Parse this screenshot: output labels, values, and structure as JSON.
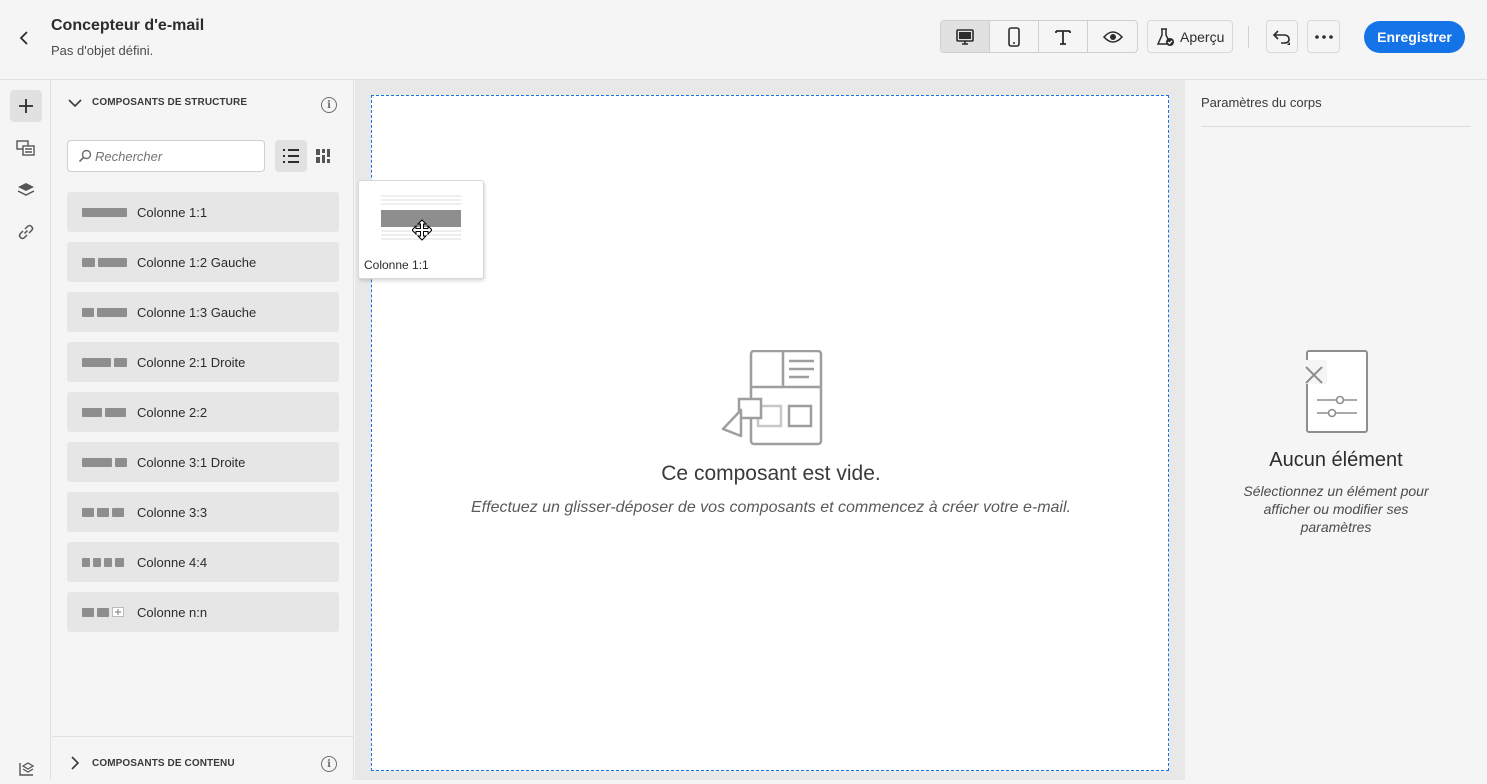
{
  "header": {
    "title": "Concepteur d'e-mail",
    "subtitle": "Pas d'objet défini.",
    "preview_label": "Aperçu",
    "save_label": "Enregistrer"
  },
  "left_panel": {
    "structure_title": "COMPOSANTS DE STRUCTURE",
    "search_placeholder": "Rechercher",
    "items": [
      {
        "label": "Colonne 1:1"
      },
      {
        "label": "Colonne 1:2 Gauche"
      },
      {
        "label": "Colonne 1:3 Gauche"
      },
      {
        "label": "Colonne 2:1 Droite"
      },
      {
        "label": "Colonne 2:2"
      },
      {
        "label": "Colonne 3:1 Droite"
      },
      {
        "label": "Colonne 3:3"
      },
      {
        "label": "Colonne 4:4"
      },
      {
        "label": "Colonne n:n"
      }
    ],
    "content_title": "COMPOSANTS DE CONTENU"
  },
  "canvas": {
    "empty_title": "Ce composant est vide.",
    "empty_desc": "Effectuez un glisser-déposer de vos composants et commencez à créer votre e-mail.",
    "drag_label": "Colonne 1:1"
  },
  "right_panel": {
    "title": "Paramètres du corps",
    "empty_title": "Aucun élément",
    "empty_desc": "Sélectionnez un élément pour afficher ou modifier ses paramètres"
  },
  "colors": {
    "accent": "#1473e6",
    "thumb": "#8e8e8e"
  }
}
